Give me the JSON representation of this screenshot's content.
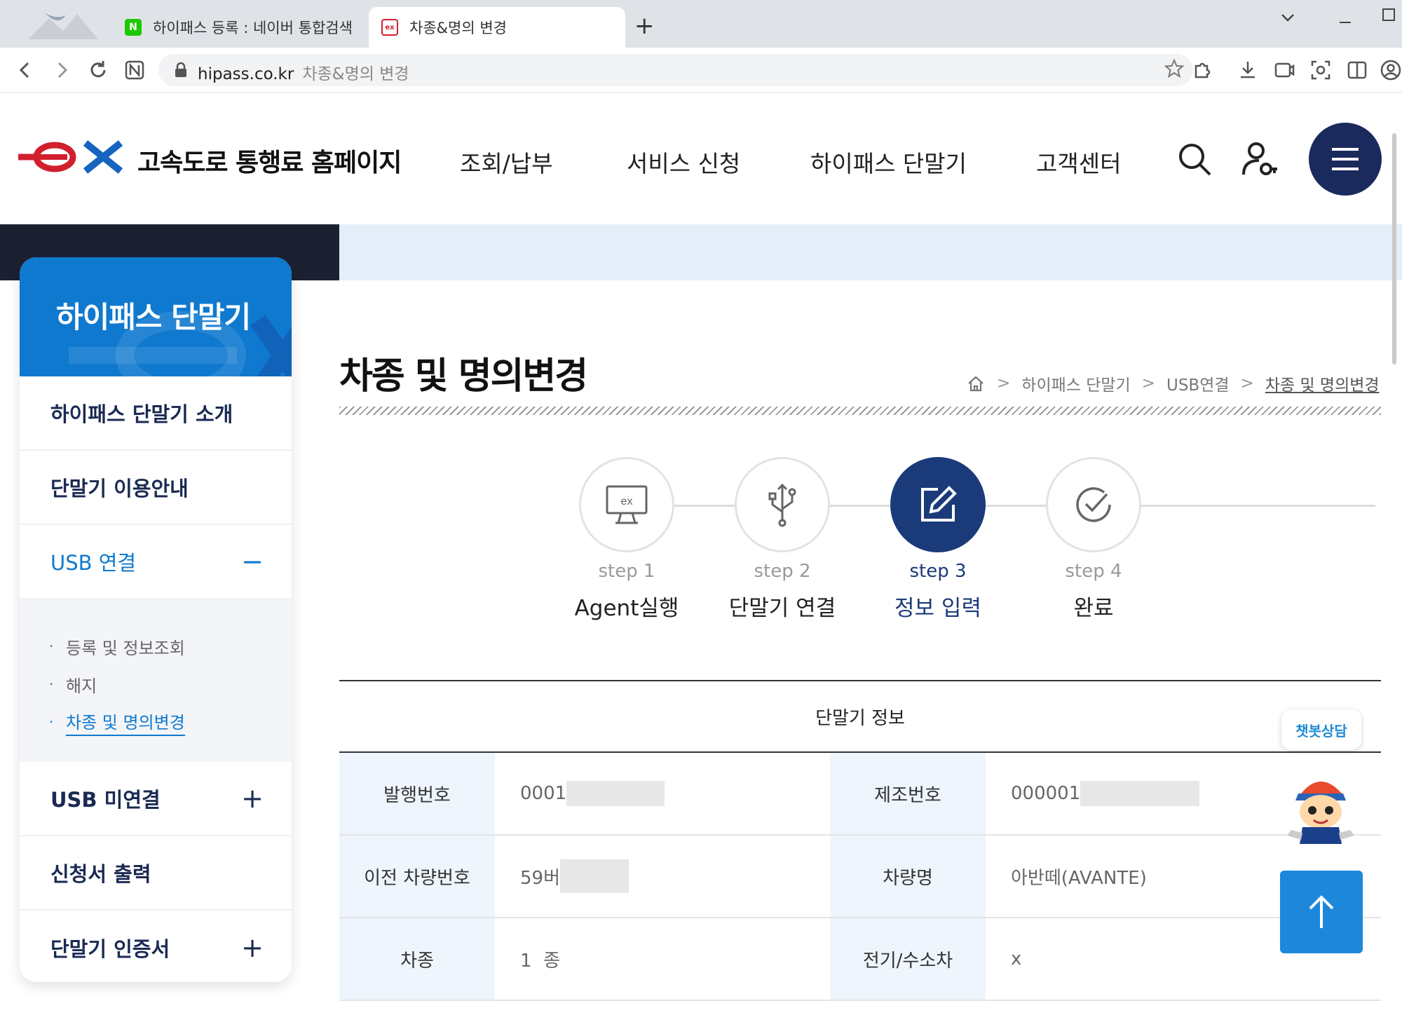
{
  "browser": {
    "tabs": [
      {
        "label": "하이패스 등록 : 네이버 통합검색",
        "favicon": "naver-favicon",
        "active": false
      },
      {
        "label": "차종&명의 변경",
        "favicon": "ex-favicon",
        "active": true
      }
    ],
    "new_tab_label": "+",
    "url_domain": "hipass.co.kr",
    "url_page_title": "차종&명의 변경"
  },
  "header": {
    "site_title": "고속도로 통행료 홈페이지",
    "nav": [
      "조회/납부",
      "서비스 신청",
      "하이패스 단말기",
      "고객센터"
    ],
    "brand_color": "#d21f2e",
    "accent_color": "#1b2a5c"
  },
  "sidebar": {
    "title": "하이패스 단말기",
    "items": [
      {
        "label": "하이패스 단말기 소개",
        "sign": ""
      },
      {
        "label": "단말기 이용안내",
        "sign": ""
      },
      {
        "label": "USB 연결",
        "sign": "−"
      },
      {
        "label": "USB 미연결",
        "sign": "+"
      },
      {
        "label": "신청서 출력",
        "sign": ""
      },
      {
        "label": "단말기 인증서",
        "sign": "+"
      }
    ],
    "sub_items": [
      "등록 및 정보조회",
      "해지",
      "차종 및 명의변경"
    ],
    "accent_color": "#0f79cf"
  },
  "main": {
    "page_title": "차종 및 명의변경",
    "breadcrumb": [
      "하이패스 단말기",
      "USB연결",
      "차종 및 명의변경"
    ],
    "steps": [
      {
        "label": "step 1",
        "name": "Agent실행",
        "icon": "monitor-ex-icon"
      },
      {
        "label": "step 2",
        "name": "단말기 연결",
        "icon": "usb-icon"
      },
      {
        "label": "step 3",
        "name": "정보 입력",
        "icon": "edit-icon"
      },
      {
        "label": "step 4",
        "name": "완료",
        "icon": "check-circle-icon"
      }
    ],
    "current_step": 3,
    "table": {
      "caption": "단말기 정보",
      "rows": [
        {
          "h1": "발행번호",
          "v1": "0001",
          "h2": "제조번호",
          "v2": "000001"
        },
        {
          "h1": "이전 차량번호",
          "v1": "59버",
          "h2": "차량명",
          "v2": "아반떼(AVANTE)"
        },
        {
          "h1": "차종",
          "v1": "1  종",
          "h2": "전기/수소차",
          "v2": "x"
        }
      ]
    }
  },
  "floating": {
    "chat_label": "챗봇상담",
    "top_button_icon": "arrow-up-icon"
  }
}
